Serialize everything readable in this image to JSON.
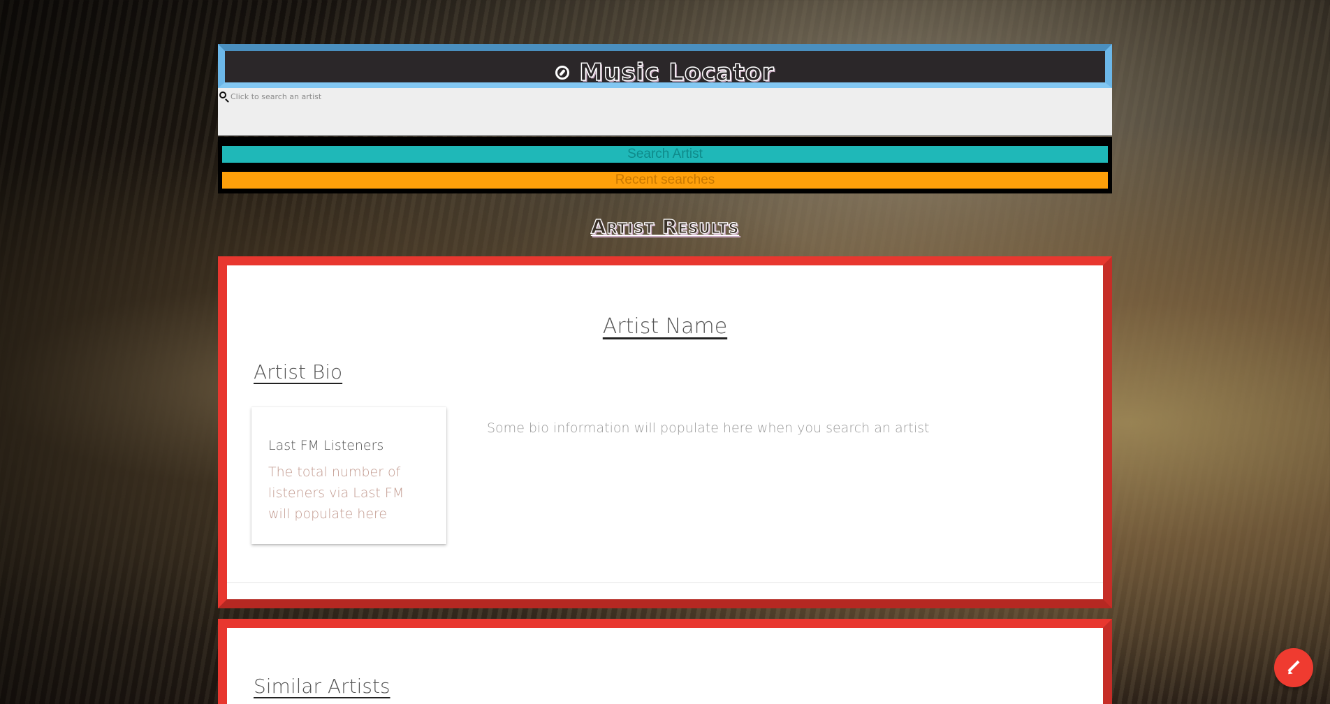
{
  "header": {
    "title": "Music Locator",
    "icon": "compass-icon"
  },
  "search": {
    "placeholder": "Click to search an artist",
    "value": "",
    "icon": "search-icon"
  },
  "buttons": {
    "search_label": "Search Artist",
    "recent_label": "Recent searches"
  },
  "results": {
    "section_title": "Artist Results",
    "artist_name": "Artist Name",
    "bio_heading": "Artist Bio",
    "listeners_title": "Last FM Listeners",
    "listeners_text": "The total number of listeners via Last FM will populate here",
    "bio_text": "Some bio information will populate here when you search an artist",
    "similar_heading": "Similar Artists"
  },
  "fab": {
    "icon": "pencil-icon"
  },
  "colors": {
    "header_border": "#6cb7e8",
    "header_bg": "#2b2729",
    "search_button": "#1fb8b8",
    "recent_button": "#ffa00a",
    "card_border": "#e8372f",
    "fab": "#ef3b30"
  }
}
